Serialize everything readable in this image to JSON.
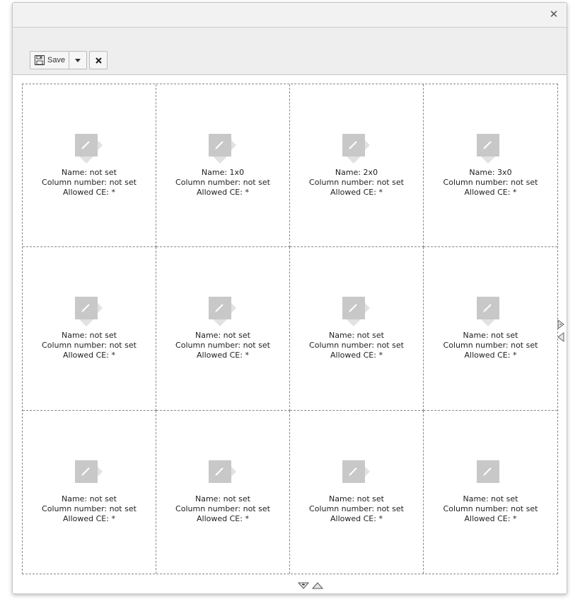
{
  "window": {
    "close_icon": "close-icon"
  },
  "toolbar": {
    "save_label": "Save",
    "save_icon": "save-disk-icon",
    "split_icon": "caret-down-icon",
    "close_icon": "close-icon"
  },
  "grid": {
    "cells": [
      {
        "name": "Name: not set",
        "column": "Column number: not set",
        "allowed": "Allowed CE: *"
      },
      {
        "name": "Name: 1x0",
        "column": "Column number: not set",
        "allowed": "Allowed CE: *"
      },
      {
        "name": "Name: 2x0",
        "column": "Column number: not set",
        "allowed": "Allowed CE: *"
      },
      {
        "name": "Name: 3x0",
        "column": "Column number: not set",
        "allowed": "Allowed CE: *"
      },
      {
        "name": "Name: not set",
        "column": "Column number: not set",
        "allowed": "Allowed CE: *"
      },
      {
        "name": "Name: not set",
        "column": "Column number: not set",
        "allowed": "Allowed CE: *"
      },
      {
        "name": "Name: not set",
        "column": "Column number: not set",
        "allowed": "Allowed CE: *"
      },
      {
        "name": "Name: not set",
        "column": "Column number: not set",
        "allowed": "Allowed CE: *"
      },
      {
        "name": "Name: not set",
        "column": "Column number: not set",
        "allowed": "Allowed CE: *"
      },
      {
        "name": "Name: not set",
        "column": "Column number: not set",
        "allowed": "Allowed CE: *"
      },
      {
        "name": "Name: not set",
        "column": "Column number: not set",
        "allowed": "Allowed CE: *"
      },
      {
        "name": "Name: not set",
        "column": "Column number: not set",
        "allowed": "Allowed CE: *"
      }
    ]
  },
  "colors": {
    "icon_gray": "#c8c8c8",
    "arrow_gray": "#e2e2e2",
    "border_dashed": "#888888"
  }
}
